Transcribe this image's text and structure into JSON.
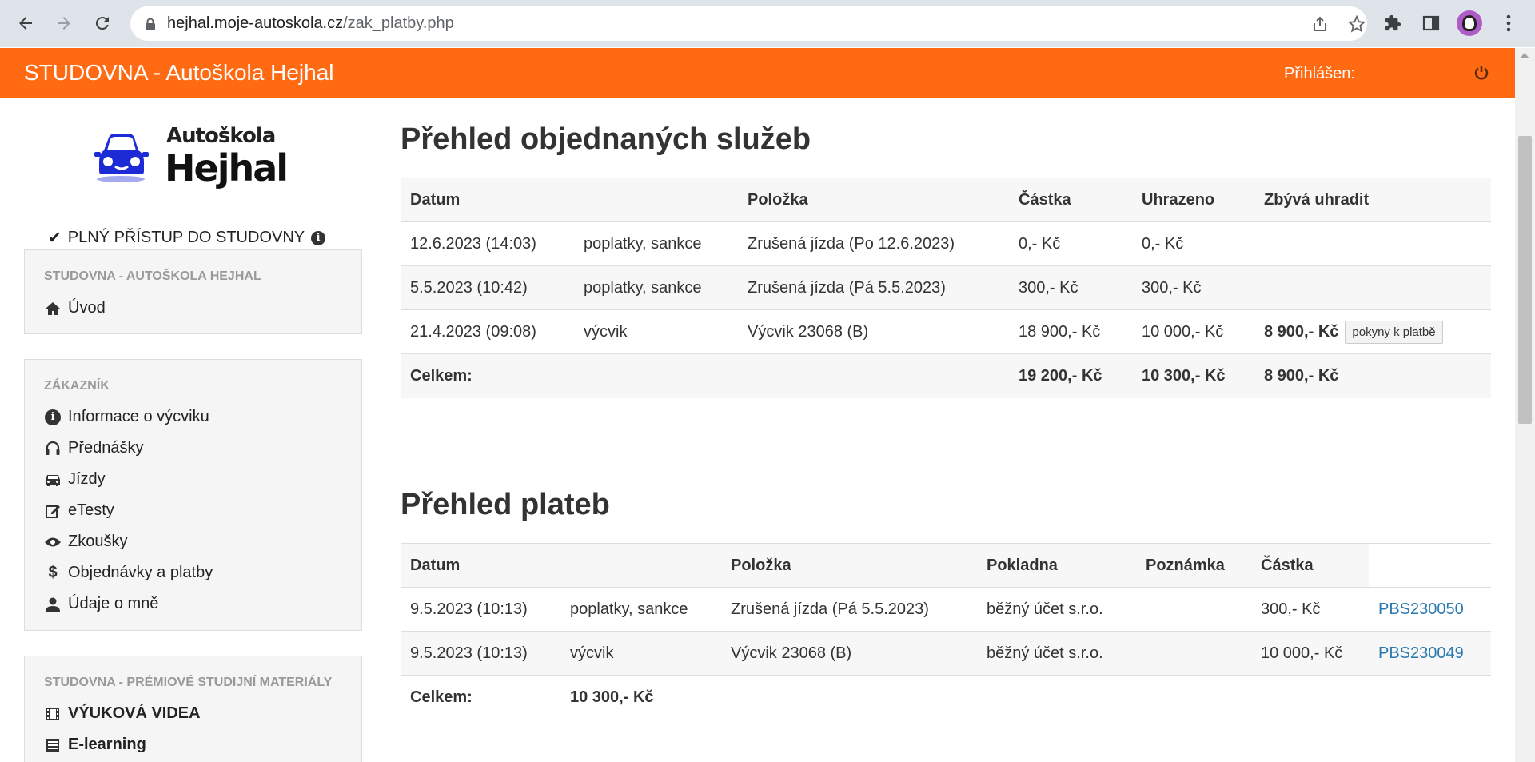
{
  "browser": {
    "url_host": "hejhal.moje-autoskola.cz",
    "url_path": "/zak_platby.php"
  },
  "header": {
    "brand": "STUDOVNA - Autoškola Hejhal",
    "login_label": "Přihlášen:"
  },
  "logo": {
    "line1": "Autoškola",
    "line2": "Hejhal"
  },
  "access_label": "PLNÝ PŘÍSTUP DO STUDOVNY",
  "sidebar": {
    "panel1": {
      "title": "STUDOVNA - AUTOŠKOLA HEJHAL",
      "items": [
        {
          "label": "Úvod",
          "icon": "home-icon"
        }
      ]
    },
    "panel2": {
      "title": "ZÁKAZNÍK",
      "items": [
        {
          "label": "Informace o výcviku",
          "icon": "info-icon"
        },
        {
          "label": "Přednášky",
          "icon": "headphones-icon"
        },
        {
          "label": "Jízdy",
          "icon": "car-icon"
        },
        {
          "label": "eTesty",
          "icon": "edit-icon"
        },
        {
          "label": "Zkoušky",
          "icon": "eye-icon"
        },
        {
          "label": "Objednávky a platby",
          "icon": "dollar-icon"
        },
        {
          "label": "Údaje o mně",
          "icon": "user-icon"
        }
      ]
    },
    "panel3": {
      "title": "STUDOVNA - PRÉMIOVÉ STUDIJNÍ MATERIÁLY",
      "items": [
        {
          "label": "VÝUKOVÁ VIDEA",
          "icon": "film-icon"
        },
        {
          "label": "E-learning",
          "icon": "list-icon"
        }
      ]
    }
  },
  "services": {
    "title": "Přehled objednaných služeb",
    "headers": [
      "Datum",
      "",
      "Položka",
      "Částka",
      "Uhrazeno",
      "Zbývá uhradit"
    ],
    "rows": [
      [
        "12.6.2023 (14:03)",
        "poplatky, sankce",
        "Zrušená jízda (Po 12.6.2023)",
        "0,- Kč",
        "0,- Kč",
        ""
      ],
      [
        "5.5.2023 (10:42)",
        "poplatky, sankce",
        "Zrušená jízda (Pá 5.5.2023)",
        "300,- Kč",
        "300,- Kč",
        ""
      ],
      [
        "21.4.2023 (09:08)",
        "výcvik",
        "Výcvik 23068 (B)",
        "18 900,- Kč",
        "10 000,- Kč",
        "8 900,- Kč"
      ]
    ],
    "pay_button": "pokyny k platbě",
    "total_label": "Celkem:",
    "total_amount": "19 200,- Kč",
    "total_paid": "10 300,- Kč",
    "total_remaining": "8 900,- Kč"
  },
  "payments": {
    "title": "Přehled plateb",
    "headers": [
      "Datum",
      "",
      "Položka",
      "Pokladna",
      "Poznámka",
      "Částka"
    ],
    "rows": [
      [
        "9.5.2023 (10:13)",
        "poplatky, sankce",
        "Zrušená jízda (Pá 5.5.2023)",
        "běžný účet s.r.o.",
        "",
        "300,- Kč",
        "PBS230050"
      ],
      [
        "9.5.2023 (10:13)",
        "výcvik",
        "Výcvik 23068 (B)",
        "běžný účet s.r.o.",
        "",
        "10 000,- Kč",
        "PBS230049"
      ]
    ],
    "total_label": "Celkem:",
    "total_amount": "10 300,- Kč"
  }
}
